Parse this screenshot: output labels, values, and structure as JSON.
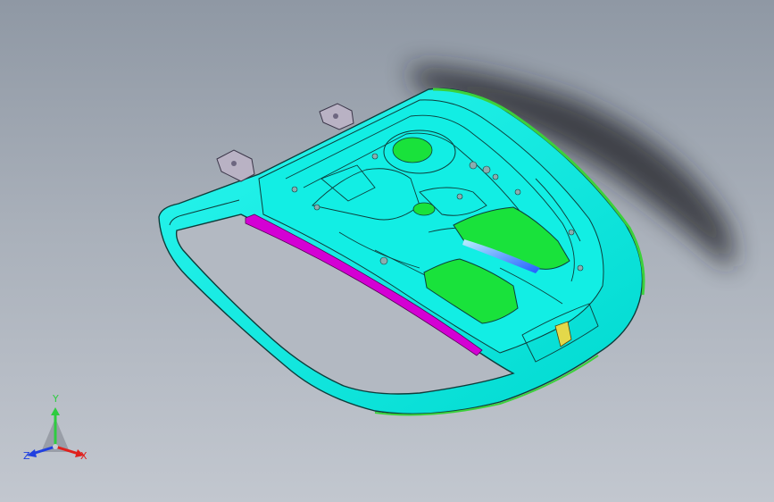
{
  "viewport": {
    "background_top": "#8f98a4",
    "background_bottom": "#c2c7cf"
  },
  "model": {
    "panel_color": "#00f0e6",
    "panel_shadow_color": "#00b8b0",
    "edge_color": "#0d3d3b",
    "highlight_color": "#19e23b",
    "strip_color": "#d400d4",
    "accent_blue": "#1f5cff",
    "hinge_color": "#b9b2c4",
    "green_rim_color": "#3bd13b"
  },
  "triad": {
    "x_label": "X",
    "y_label": "Y",
    "z_label": "Z",
    "x_color": "#e0201c",
    "y_color": "#2ecc40",
    "z_color": "#2040e0"
  }
}
